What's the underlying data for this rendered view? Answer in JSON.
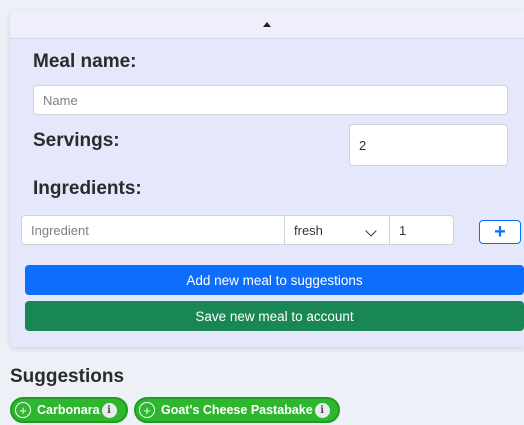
{
  "form": {
    "meal_name_label": "Meal name:",
    "meal_name_placeholder": "Name",
    "servings_label": "Servings:",
    "servings_value": "2",
    "ingredients_label": "Ingredients:",
    "ingredient_placeholder": "Ingredient",
    "ingredient_type_selected": "fresh",
    "ingredient_quantity": "1",
    "add_ingredient_symbol": "+",
    "add_to_suggestions_label": "Add new meal to suggestions",
    "save_to_account_label": "Save new meal to account"
  },
  "suggestions": {
    "title": "Suggestions",
    "items": [
      {
        "label": "Carbonara"
      },
      {
        "label": "Goat's Cheese Pastabake"
      }
    ]
  },
  "icons": {
    "collapse": "caret-up-icon",
    "add_chip": "plus-circle-icon",
    "info": "info-icon"
  },
  "colors": {
    "primary": "#0d6efd",
    "success": "#198754",
    "chip": "#2fb62f",
    "panel": "#e5e7fa"
  }
}
